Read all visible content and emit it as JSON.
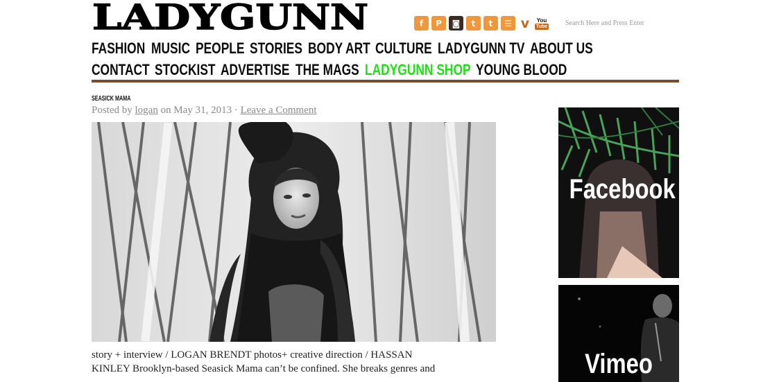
{
  "site": {
    "logo_text": "LADYGUNN",
    "search_placeholder": "Search Here and Press Enter"
  },
  "social": [
    {
      "name": "facebook-icon",
      "glyph": "f"
    },
    {
      "name": "pinterest-icon",
      "glyph": "P"
    },
    {
      "name": "instagram-icon",
      "glyph": "◙"
    },
    {
      "name": "tumblr-icon",
      "glyph": "t"
    },
    {
      "name": "twitter-icon",
      "glyph": "t"
    },
    {
      "name": "rss-icon",
      "glyph": "☰"
    },
    {
      "name": "vimeo-icon",
      "glyph": "v"
    },
    {
      "name": "youtube-icon",
      "glyph_top": "You",
      "glyph_bottom": "Tube"
    }
  ],
  "nav": {
    "row1": [
      "FASHION",
      "MUSIC",
      "PEOPLE",
      "STORIES",
      "BODY ART",
      "CULTURE",
      "LADYGUNN TV",
      "ABOUT US"
    ],
    "row2": [
      "CONTACT",
      "STOCKIST",
      "ADVERTISE",
      "THE MAGS",
      "LADYGUNN SHOP",
      "YOUNG BLOOD"
    ],
    "highlight": "LADYGUNN SHOP"
  },
  "post": {
    "kicker": "SEASICK MAMA",
    "posted_by": "Posted by",
    "author": "logan",
    "on": "on",
    "date": "May 31, 2013",
    "separator": "·",
    "comment_link": "Leave a Comment",
    "body_line1": "story + interview / LOGAN BRENDT photos+  creative direction / HASSAN",
    "body_line2": "KINLEY Brooklyn-based Seasick Mama can’t be confined. She breaks genres and"
  },
  "sidebar": {
    "facebook_label": "Facebook",
    "vimeo_label": "Vimeo"
  },
  "colors": {
    "accent_green": "#1ee013",
    "rule_brown": "#7a4b2d",
    "icon_orange": "#f0963b"
  }
}
